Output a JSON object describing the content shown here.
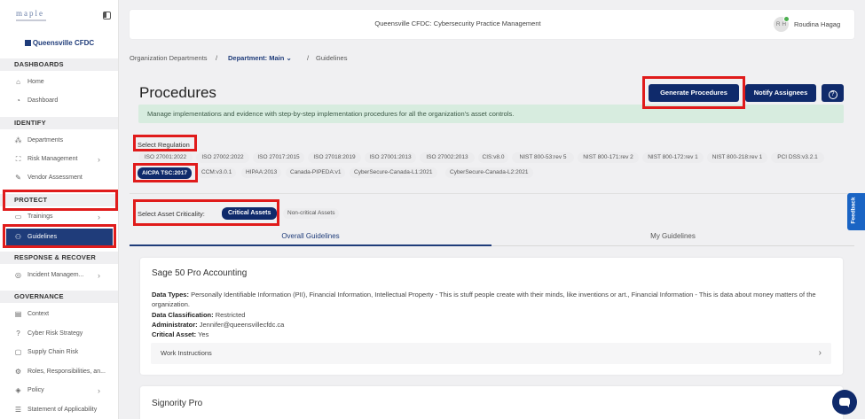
{
  "sidebar": {
    "logo": "maple",
    "org_name": "Queensville CFDC",
    "sections": {
      "dashboards": "DASHBOARDS",
      "identify": "IDENTIFY",
      "protect": "PROTECT",
      "respond": "RESPONSE & RECOVER",
      "governance": "GOVERNANCE"
    },
    "items": {
      "home": "Home",
      "dashboard": "Dashboard",
      "departments": "Departments",
      "risk_management": "Risk Management",
      "vendor_assessment": "Vendor Assessment",
      "trainings": "Trainings",
      "guidelines": "Guidelines",
      "incident_management": "Incident Managem...",
      "context": "Context",
      "cyber_risk_strategy": "Cyber Risk Strategy",
      "supply_chain_risk": "Supply Chain Risk",
      "roles": "Roles, Responsibilities, an...",
      "policy": "Policy",
      "soa": "Statement of Applicability"
    }
  },
  "header": {
    "title": "Queensville CFDC: Cybersecurity Practice Management",
    "user_initials": "R H",
    "user_name": "Roudina Hagag"
  },
  "breadcrumb": {
    "org_departments": "Organization Departments",
    "sep1": "/",
    "department": "Department: Main",
    "sep2": "/",
    "current": "Guidelines"
  },
  "page": {
    "title": "Procedures",
    "generate_button": "Generate Procedures",
    "notify_button": "Notify Assignees",
    "help_icon": "?",
    "info": "Manage implementations and evidence with step-by-step implementation procedures for all the organization's asset controls."
  },
  "regulation": {
    "label": "Select Regulation",
    "options_row1": [
      "ISO 27001:2022",
      "ISO 27002:2022",
      "ISO 27017:2015",
      "ISO 27018:2019",
      "ISO 27001:2013",
      "ISO 27002:2013",
      "CIS:v8.0",
      "NIST 800-53:rev 5",
      "NIST 800-171:rev 2",
      "NIST 800-172:rev 1",
      "NIST 800-218:rev 1",
      "PCI DSS:v3.2.1"
    ],
    "options_row2": [
      "AICPA TSC:2017",
      "CCM:v3.0.1",
      "HIPAA:2013",
      "Canada-PIPEDA:v1",
      "CyberSecure-Canada-L1:2021",
      "CyberSecure-Canada-L2:2021"
    ],
    "selected": "AICPA TSC:2017"
  },
  "criticality": {
    "label": "Select Asset Criticality:",
    "critical": "Critical Assets",
    "non_critical": "Non-critical Assets"
  },
  "tabs": {
    "overall": "Overall Guidelines",
    "mine": "My Guidelines"
  },
  "cards": [
    {
      "title": "Sage 50 Pro Accounting",
      "data_types_label": "Data Types:",
      "data_types": "Personally Identifiable Information (PII), Financial Information, Intellectual Property - This is stuff people create with their minds, like inventions or art., Financial Information - This is data about money matters of the organization.",
      "classification_label": "Data Classification:",
      "classification": "Restricted",
      "administrator_label": "Administrator:",
      "administrator": "Jennifer@queensvillecfdc.ca",
      "critical_label": "Critical Asset:",
      "critical": "Yes",
      "work_instructions": "Work Instructions"
    },
    {
      "title": "Signority Pro"
    }
  ],
  "feedback": "Feedback",
  "colors": {
    "primary": "#0f2a6b",
    "highlight": "#e01b1b",
    "banner": "#d7ecdf"
  }
}
